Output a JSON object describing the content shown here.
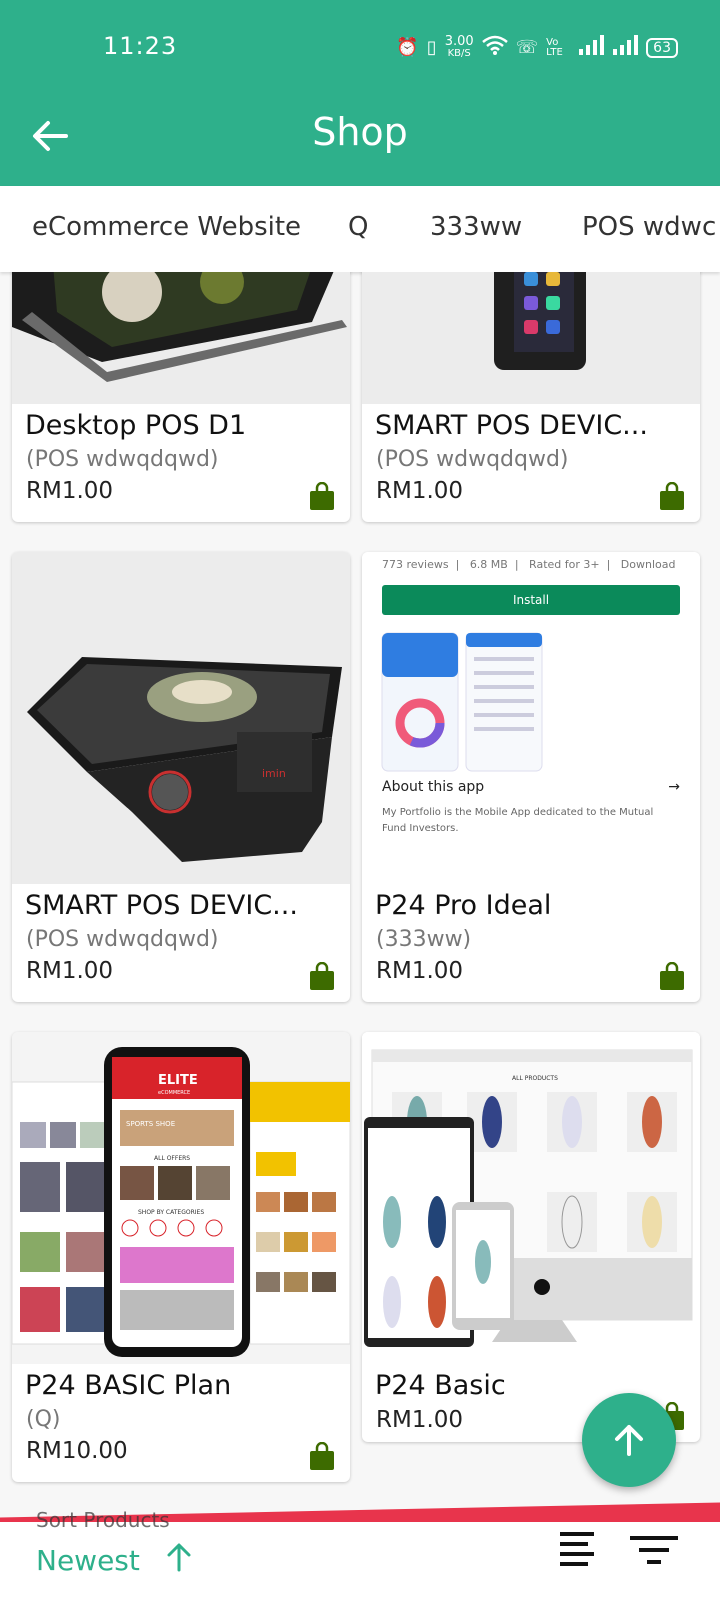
{
  "status": {
    "time": "11:23",
    "net_speed": "3.00",
    "net_unit": "KB/S",
    "volte": "Vo LTE",
    "battery": "63"
  },
  "appbar": {
    "title": "Shop"
  },
  "tabs": [
    "eCommerce Website",
    "Q",
    "333ww",
    "POS wdwc"
  ],
  "products": [
    {
      "name": "Desktop POS D1",
      "category": "(POS wdwqdqwd)",
      "price": "RM1.00"
    },
    {
      "name": "SMART POS DEVIC...",
      "category": "(POS wdwqdqwd)",
      "price": "RM1.00"
    },
    {
      "name": "SMART POS DEVIC...",
      "category": "(POS wdwqdqwd)",
      "price": "RM1.00"
    },
    {
      "name": "P24 Pro Ideal",
      "category": "(333ww)",
      "price": "RM1.00"
    },
    {
      "name": "P24 BASIC Plan",
      "category": "(Q)",
      "price": "RM10.00"
    },
    {
      "name": "P24 Basic",
      "category": "",
      "price": "RM1.00"
    }
  ],
  "app_screenshot": {
    "reviews": "773 reviews",
    "size": "6.8 MB",
    "rated": "Rated for 3+",
    "download": "Download",
    "install": "Install",
    "about": "About this app",
    "desc": "My Portfolio is the Mobile App dedicated to the Mutual Fund Investors."
  },
  "elite_banner": {
    "brand": "ELITE",
    "sub": "eCOMMERCE",
    "offers": "ALL OFFERS",
    "sports_shoe": "SPORTS SHOE",
    "categories": "SHOP BY CATEGORIES"
  },
  "store_banner": {
    "heading": "ALL PRODUCTS"
  },
  "footer": {
    "hidden_label": "Sort Products",
    "sort_label": "Newest"
  },
  "colors": {
    "primary": "#2eb08b",
    "accent_red": "#e8344c",
    "bag_green": "#3d6b00"
  }
}
